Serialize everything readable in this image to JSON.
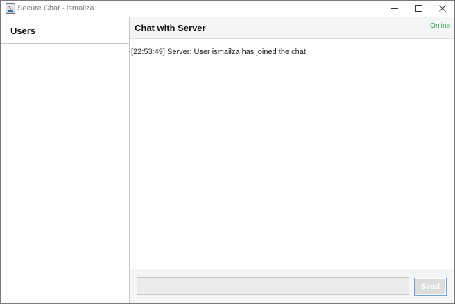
{
  "window": {
    "title": "Secure Chat - ismailza"
  },
  "titlebar_icons": [
    "app-icon",
    "minimize-icon",
    "maximize-icon",
    "close-icon"
  ],
  "users_panel": {
    "title": "Users",
    "items": []
  },
  "chat": {
    "title": "Chat with Server",
    "status": "Online",
    "status_color": "#2f9e3b",
    "messages": [
      {
        "text": "[22:53:49] Server: User ismailza has joined the chat"
      }
    ]
  },
  "composer": {
    "input_value": "",
    "send_label": "Send",
    "send_border_color": "#6ea0dc"
  }
}
